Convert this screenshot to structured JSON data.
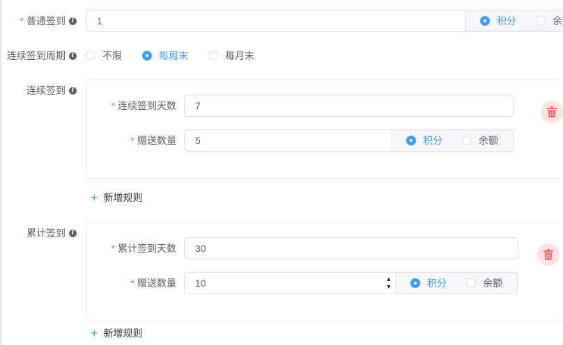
{
  "normal_checkin": {
    "label": "普通签到",
    "value": "1",
    "options": [
      "积分",
      "余额"
    ],
    "selected": "积分"
  },
  "continuous_period": {
    "label": "连续签到周期",
    "options": [
      "不限",
      "每周末",
      "每月末"
    ],
    "selected": "每周末"
  },
  "continuous_checkin": {
    "label": "连续签到",
    "days_label": "连续签到天数",
    "days_value": "7",
    "gift_label": "赠送数量",
    "gift_value": "5",
    "options": [
      "积分",
      "余额"
    ],
    "selected": "积分",
    "add_rule": "新增规则"
  },
  "cumulative_checkin": {
    "label": "累计签到",
    "days_label": "累计签到天数",
    "days_value": "30",
    "gift_label": "赠送数量",
    "gift_value": "10",
    "options": [
      "积分",
      "余额"
    ],
    "selected": "积分",
    "add_rule": "新增规则"
  },
  "icons": {
    "info": "i",
    "delete": "trash-icon",
    "add": "+"
  },
  "colors": {
    "primary": "#409eff",
    "danger": "#f56c6c",
    "text": "#606266"
  }
}
